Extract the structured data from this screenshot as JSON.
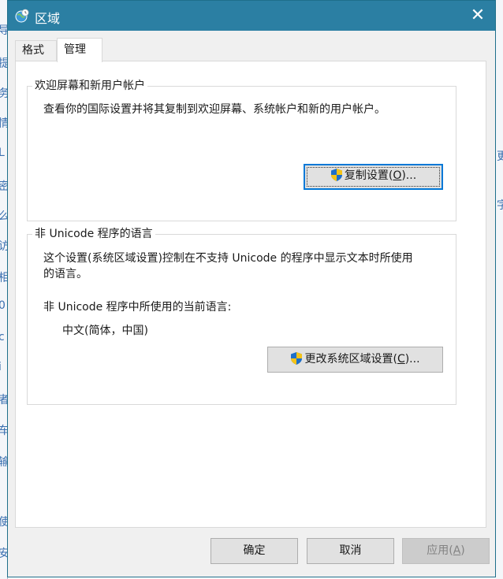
{
  "background": {
    "left_glyphs": [
      "导",
      "提",
      "务",
      "情",
      "L",
      "密",
      "么",
      "访",
      "相",
      "0",
      "c",
      "i",
      "者",
      "车",
      "输",
      "使",
      "安"
    ],
    "right_glyphs": [
      "更",
      "字"
    ]
  },
  "dialog": {
    "title": "区域",
    "close_glyph": "✕"
  },
  "tabs": [
    {
      "label": "格式"
    },
    {
      "label": "管理"
    }
  ],
  "welcome_group": {
    "title": "欢迎屏幕和新用户帐户",
    "description": "查看你的国际设置并将其复制到欢迎屏幕、系统帐户和新的用户帐户。",
    "copy_button": {
      "text_before": "复制设置(",
      "mnemonic": "O",
      "text_after": ")..."
    }
  },
  "unicode_group": {
    "title": "非 Unicode 程序的语言",
    "description_line1": "这个设置(系统区域设置)控制在不支持 Unicode 的程序中显示文本时所使用",
    "description_line2": "的语言。",
    "current_label": "非 Unicode 程序中所使用的当前语言:",
    "current_value": "中文(简体，中国)",
    "change_button": {
      "text_before": "更改系统区域设置(",
      "mnemonic": "C",
      "text_after": ")..."
    }
  },
  "footer": {
    "ok": "确定",
    "cancel": "取消",
    "apply_before": "应用(",
    "apply_mnemonic": "A",
    "apply_after": ")"
  },
  "colors": {
    "titlebar": "#2b7fa3",
    "dialog_bg": "#f0f0f0",
    "focus_border": "#0078d7"
  }
}
